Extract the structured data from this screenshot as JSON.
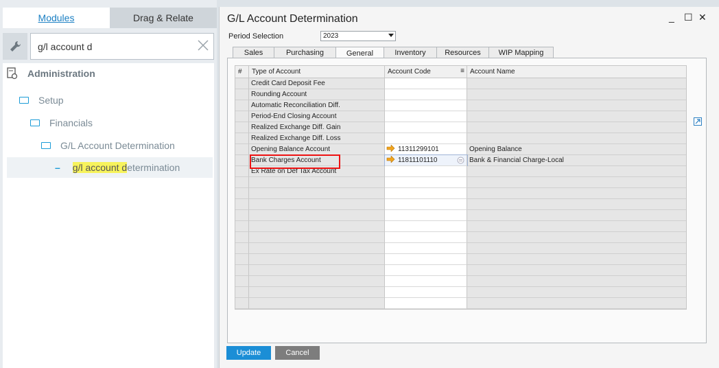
{
  "nav": {
    "tabs": {
      "modules": "Modules",
      "drag_relate": "Drag & Relate"
    },
    "search_value": "g/l account d",
    "tree": {
      "administration": "Administration",
      "setup": "Setup",
      "financials": "Financials",
      "gl_determination": "G/L Account Determination",
      "result_hl": "g/l account d",
      "result_rest": "etermination"
    }
  },
  "window": {
    "title": "G/L Account Determination",
    "controls": {
      "minimize": "_",
      "maximize": "☐",
      "close": "✕"
    },
    "period_label": "Period Selection",
    "period_value": "2023",
    "tabs": [
      "Sales",
      "Purchasing",
      "General",
      "Inventory",
      "Resources",
      "WIP Mapping"
    ],
    "active_tab": "General",
    "columns": {
      "num": "#",
      "type": "Type of Account",
      "code": "Account Code",
      "name": "Account Name"
    },
    "rows": [
      {
        "type": "Credit Card Deposit Fee",
        "code": "",
        "name": ""
      },
      {
        "type": "Rounding Account",
        "code": "",
        "name": ""
      },
      {
        "type": "Automatic Reconciliation Diff.",
        "code": "",
        "name": ""
      },
      {
        "type": "Period-End Closing Account",
        "code": "",
        "name": ""
      },
      {
        "type": "Realized Exchange Diff. Gain",
        "code": "",
        "name": ""
      },
      {
        "type": "Realized Exchange Diff. Loss",
        "code": "",
        "name": ""
      },
      {
        "type": "Opening Balance Account",
        "code": "11311299101",
        "name": "Opening Balance"
      },
      {
        "type": "Bank Charges Account",
        "code": "11811101110",
        "name": "Bank & Financial Charge-Local"
      },
      {
        "type": "Ex Rate on Def Tax Account",
        "code": "",
        "name": ""
      }
    ],
    "buttons": {
      "update": "Update",
      "cancel": "Cancel"
    }
  },
  "colors": {
    "accent": "#1b8ed6",
    "highlight_box": "#ee1111",
    "search_highlight": "#f7f35c"
  }
}
